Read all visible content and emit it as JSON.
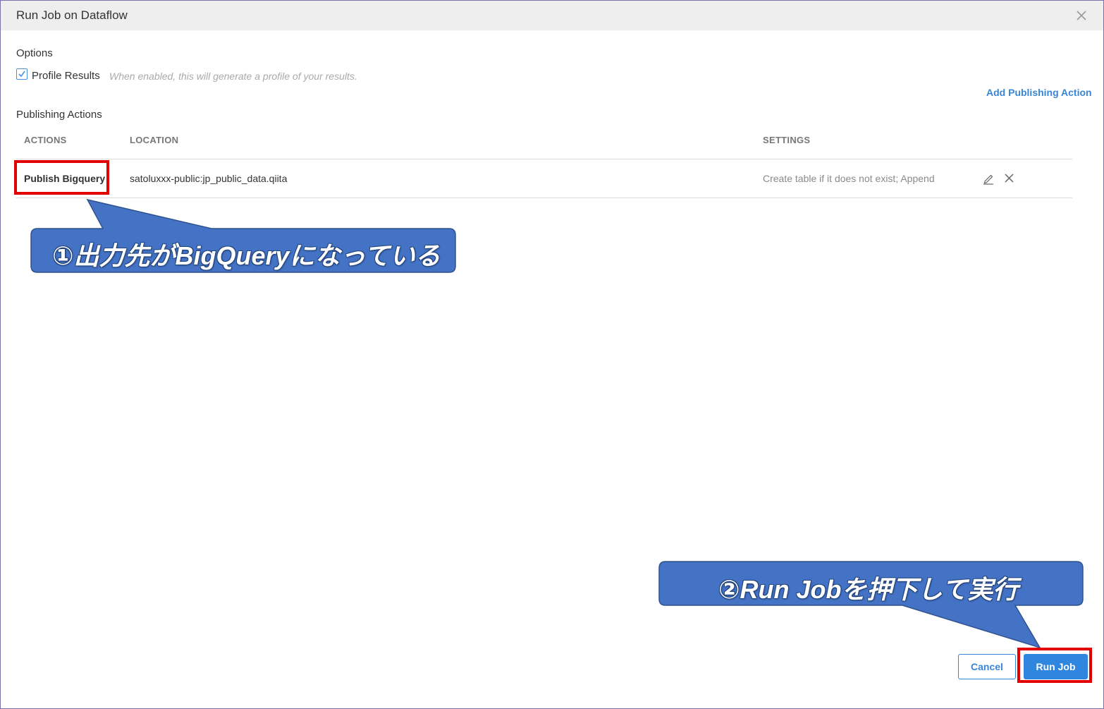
{
  "dialog": {
    "title": "Run Job on Dataflow"
  },
  "options": {
    "label": "Options",
    "profile_results": {
      "checked": true,
      "label": "Profile Results",
      "hint": "When enabled, this will generate a profile of your results."
    }
  },
  "publishing": {
    "label": "Publishing Actions",
    "add_action_label": "Add Publishing Action",
    "columns": [
      "ACTIONS",
      "LOCATION",
      "SETTINGS"
    ],
    "rows": [
      {
        "action": "Publish Bigquery",
        "location": "satoluxxx-public:jp_public_data.qiita",
        "settings": "Create table if it does not exist; Append"
      }
    ]
  },
  "footer": {
    "cancel_label": "Cancel",
    "run_label": "Run Job"
  },
  "annotations": {
    "callout_1": "①出力先がBigQueryになっている",
    "callout_2": "②Run Jobを押下して実行"
  },
  "colors": {
    "accent": "#2e86de",
    "highlight_box": "#e30000",
    "callout_fill": "#4472c4"
  },
  "icons": [
    "close-icon",
    "check-icon",
    "edit-pencil-icon",
    "delete-x-icon"
  ]
}
